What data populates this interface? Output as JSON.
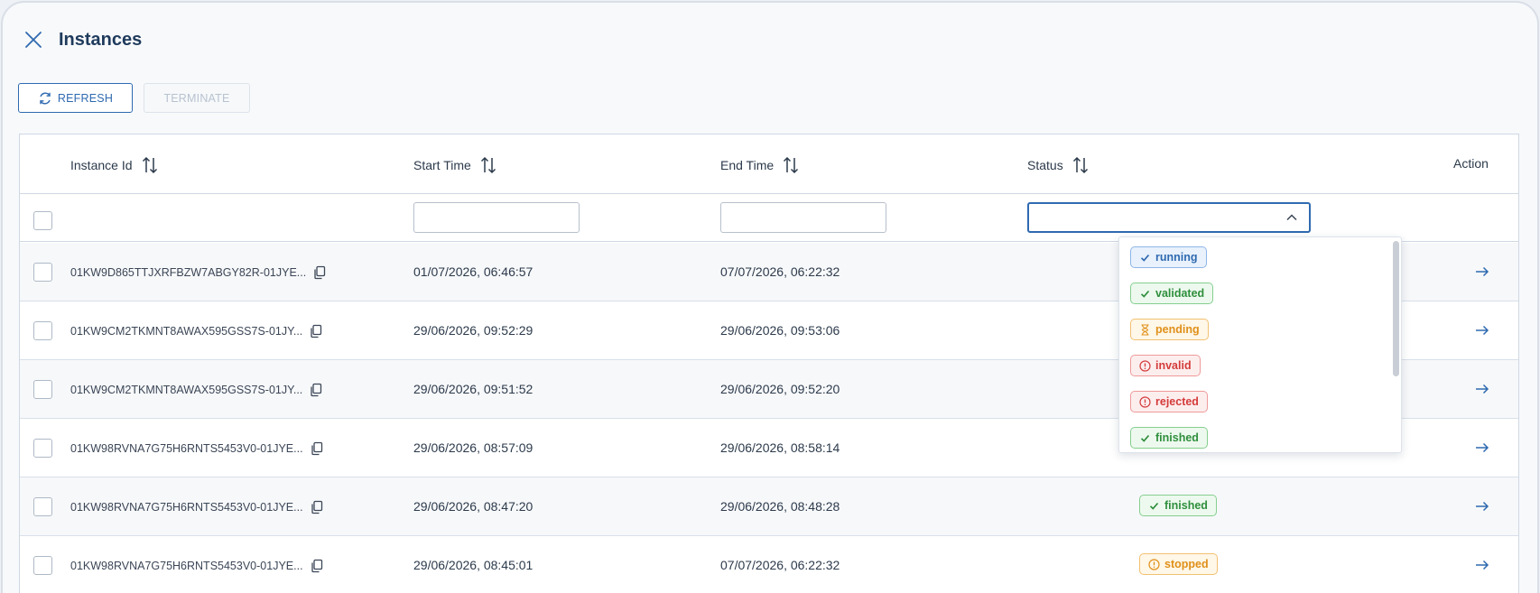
{
  "header": {
    "title": "Instances"
  },
  "toolbar": {
    "refresh_label": "REFRESH",
    "terminate_label": "TERMINATE"
  },
  "table": {
    "columns": [
      "Instance Id",
      "Start Time",
      "End Time",
      "Status",
      "Action"
    ],
    "rows": [
      {
        "id": "01KW9D865TTJXRFBZW7ABGY82R-01JYE...",
        "start": "01/07/2026, 06:46:57",
        "end": "07/07/2026, 06:22:32",
        "status": ""
      },
      {
        "id": "01KW9CM2TKMNT8AWAX595GSS7S-01JY...",
        "start": "29/06/2026, 09:52:29",
        "end": "29/06/2026, 09:53:06",
        "status": ""
      },
      {
        "id": "01KW9CM2TKMNT8AWAX595GSS7S-01JY...",
        "start": "29/06/2026, 09:51:52",
        "end": "29/06/2026, 09:52:20",
        "status": ""
      },
      {
        "id": "01KW98RVNA7G75H6RNTS5453V0-01JYE...",
        "start": "29/06/2026, 08:57:09",
        "end": "29/06/2026, 08:58:14",
        "status": ""
      },
      {
        "id": "01KW98RVNA7G75H6RNTS5453V0-01JYE...",
        "start": "29/06/2026, 08:47:20",
        "end": "29/06/2026, 08:48:28",
        "status": "finished"
      },
      {
        "id": "01KW98RVNA7G75H6RNTS5453V0-01JYE...",
        "start": "29/06/2026, 08:45:01",
        "end": "07/07/2026, 06:22:32",
        "status": "stopped"
      }
    ]
  },
  "status_options": [
    "running",
    "validated",
    "pending",
    "invalid",
    "rejected",
    "finished"
  ],
  "colors": {
    "accent": "#2f6ab0",
    "success": "#2f8f3d",
    "warning": "#e0901a",
    "danger": "#d43b3b"
  }
}
